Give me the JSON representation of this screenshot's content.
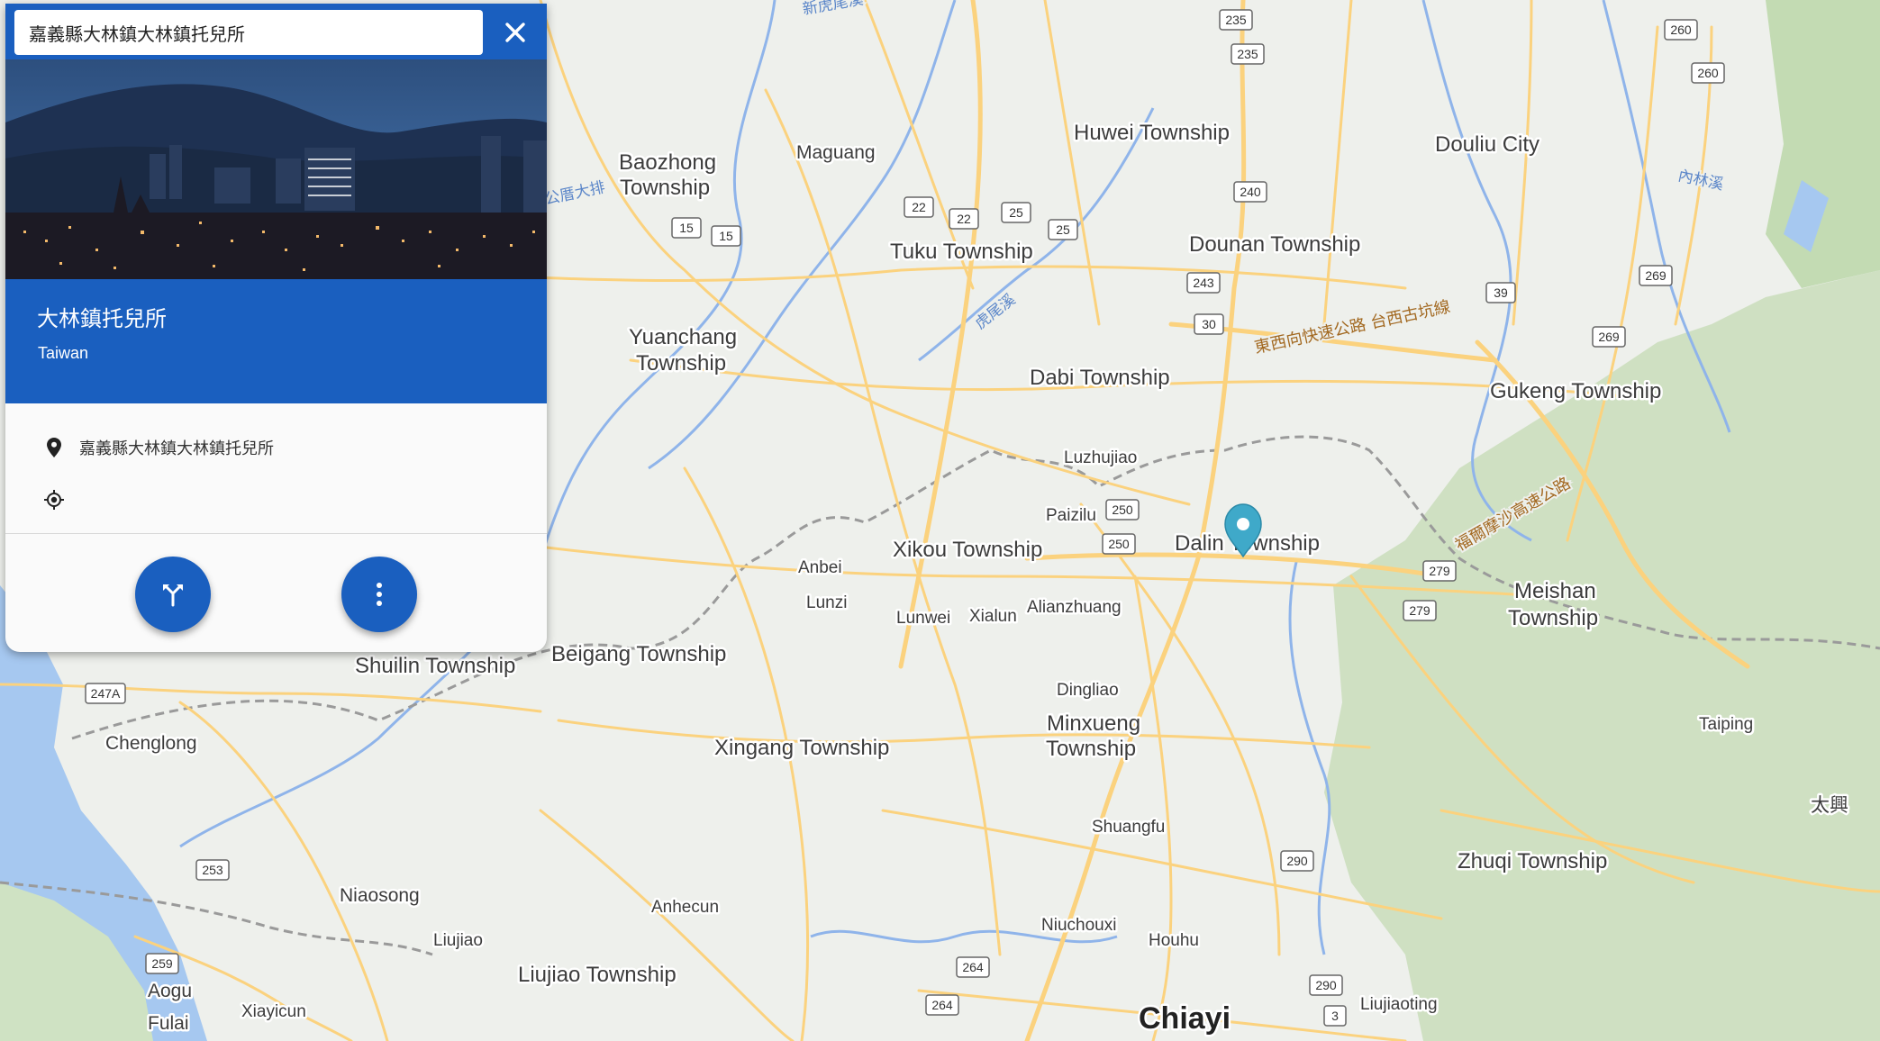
{
  "search": {
    "value": "嘉義縣大林鎮大林鎮托兒所"
  },
  "place": {
    "title": "大林鎮托兒所",
    "subtitle": "Taiwan",
    "address": "嘉義縣大林鎮大林鎮托兒所",
    "coordinates": ""
  },
  "icons": {
    "close": "close-icon",
    "location_pin": "location-pin-icon",
    "my_location": "crosshair-icon",
    "directions": "directions-icon",
    "more": "more-vert-icon",
    "marker": "map-marker-icon"
  },
  "colors": {
    "accent": "#1a5fbf",
    "marker": "#3fa9c9",
    "hill": "#c9dfb9",
    "water": "#a6c8f0",
    "road": "#fbd27e"
  },
  "map": {
    "places": [
      {
        "name": "Huwei Township"
      },
      {
        "name": "Douliu City"
      },
      {
        "name": "Baozhong"
      },
      {
        "name": "Township"
      },
      {
        "name": "Maguang"
      },
      {
        "name": "Tuku Township"
      },
      {
        "name": "Dounan Township"
      },
      {
        "name": "Yuanchang"
      },
      {
        "name": "Township"
      },
      {
        "name": "Dabi Township"
      },
      {
        "name": "Gukeng Township"
      },
      {
        "name": "Luzhujiao"
      },
      {
        "name": "Paizilu"
      },
      {
        "name": "Dalin Township"
      },
      {
        "name": "Xikou Township"
      },
      {
        "name": "Anbei"
      },
      {
        "name": "Lunzi"
      },
      {
        "name": "Lunwei"
      },
      {
        "name": "Xialun"
      },
      {
        "name": "Alianzhuang"
      },
      {
        "name": "Meishan"
      },
      {
        "name": "Township"
      },
      {
        "name": "Shuilin Township"
      },
      {
        "name": "Beigang Township"
      },
      {
        "name": "Dingliao"
      },
      {
        "name": "Minxueng"
      },
      {
        "name": "Township"
      },
      {
        "name": "Chenglong"
      },
      {
        "name": "Xingang Township"
      },
      {
        "name": "Taiping"
      },
      {
        "name": "太興"
      },
      {
        "name": "Shuangfu"
      },
      {
        "name": "Zhuqi Township"
      },
      {
        "name": "Niaosong"
      },
      {
        "name": "Anhecun"
      },
      {
        "name": "Liujiao"
      },
      {
        "name": "Niuchouxi"
      },
      {
        "name": "Houhu"
      },
      {
        "name": "Aogu"
      },
      {
        "name": "Liujiao Township"
      },
      {
        "name": "Liujiaoting"
      },
      {
        "name": "Fulai"
      },
      {
        "name": "Xiayicun"
      },
      {
        "name": "Chiayi"
      }
    ],
    "water_labels": [
      "新虎尾溪",
      "公厝大排",
      "虎尾溪",
      "內林溪"
    ],
    "road_labels": [
      "東西向快速公路 台西古坑線",
      "福爾摩沙高速公路"
    ],
    "shields": [
      "235",
      "235",
      "260",
      "260",
      "240",
      "22",
      "22",
      "25",
      "25",
      "15",
      "15",
      "243",
      "30",
      "39",
      "269",
      "269",
      "250",
      "250",
      "279",
      "279",
      "247A",
      "253",
      "290",
      "259",
      "264",
      "264",
      "290",
      "3"
    ]
  }
}
